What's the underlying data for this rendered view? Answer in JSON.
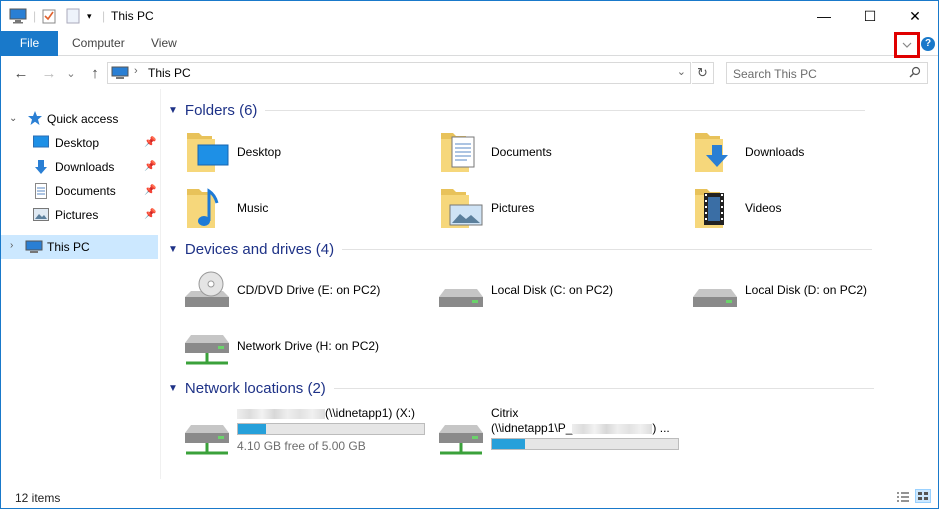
{
  "window": {
    "title": "This PC"
  },
  "window_controls": {
    "minimize": "—",
    "maximize": "☐",
    "close": "✕"
  },
  "ribbon": {
    "tabs": [
      "File",
      "Computer",
      "View"
    ],
    "expand_icon": "chevron-down-icon",
    "help_label": "?"
  },
  "navigation": {
    "back": "←",
    "forward": "→",
    "recent": "⌄",
    "up": "↑"
  },
  "address_bar": {
    "path": "This PC"
  },
  "search": {
    "placeholder": "Search This PC"
  },
  "sidebar": {
    "quick_access": "Quick access",
    "pinned": [
      {
        "label": "Desktop",
        "icon": "desktop-icon"
      },
      {
        "label": "Downloads",
        "icon": "downloads-icon"
      },
      {
        "label": "Documents",
        "icon": "documents-icon"
      },
      {
        "label": "Pictures",
        "icon": "pictures-icon"
      }
    ],
    "this_pc": "This PC"
  },
  "groups": {
    "folders": {
      "title": "Folders (6)",
      "items": [
        {
          "name": "Desktop",
          "icon": "desktop-folder-icon"
        },
        {
          "name": "Documents",
          "icon": "documents-folder-icon"
        },
        {
          "name": "Downloads",
          "icon": "downloads-folder-icon"
        },
        {
          "name": "Music",
          "icon": "music-folder-icon"
        },
        {
          "name": "Pictures",
          "icon": "pictures-folder-icon"
        },
        {
          "name": "Videos",
          "icon": "videos-folder-icon"
        }
      ]
    },
    "devices": {
      "title": "Devices and drives (4)",
      "items": [
        {
          "name": "CD/DVD Drive (E: on PC2)",
          "icon": "dvd-drive-icon"
        },
        {
          "name": "Local Disk (C: on PC2)",
          "icon": "local-disk-icon"
        },
        {
          "name": "Local Disk (D: on PC2)",
          "icon": "local-disk-icon"
        },
        {
          "name": "Network Drive (H: on PC2)",
          "icon": "network-drive-icon"
        }
      ]
    },
    "network": {
      "title": "Network locations (2)",
      "items": [
        {
          "name_suffix": "(\\\\idnetapp1) (X:)",
          "usage_fraction": 0.15,
          "free_text": "4.10 GB free of 5.00 GB",
          "icon": "network-drive-icon"
        },
        {
          "name_line1": "Citrix",
          "name_line2_prefix": "(\\\\idnetapp1\\P_",
          "name_line2_suffix": ") ...",
          "usage_fraction": 0.18,
          "icon": "network-drive-icon"
        }
      ]
    }
  },
  "status_bar": {
    "item_count": "12 items"
  },
  "colors": {
    "accent": "#1979ca",
    "group_header": "#1e3287",
    "selection": "#cce8ff",
    "highlight_box": "#e00000",
    "progress": "#26a0da"
  }
}
